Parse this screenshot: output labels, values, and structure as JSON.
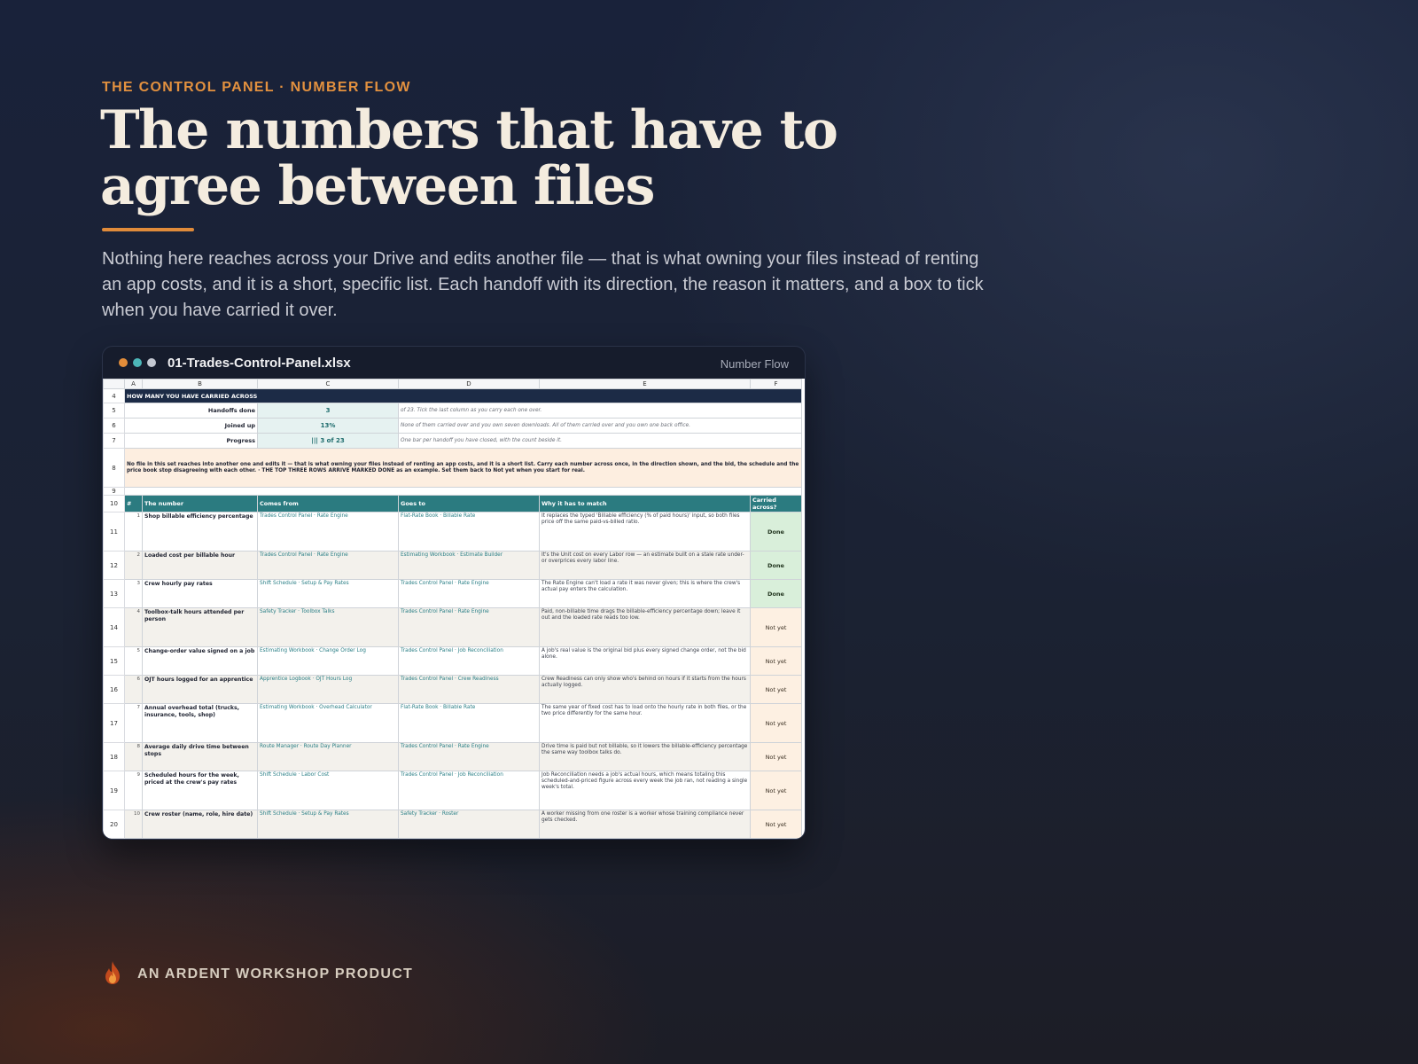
{
  "page": {
    "eyebrow": "THE CONTROL PANEL · NUMBER FLOW",
    "headline": "The numbers that have to agree between files",
    "lead": "Nothing here reaches across your Drive and edits another file — that is what owning your files instead of renting an app costs, and it is a short, specific list. Each handoff with its direction, the reason it matters, and a box to tick when you have carried it over."
  },
  "window": {
    "filename": "01-Trades-Control-Panel.xlsx",
    "tab_label": "Number Flow",
    "dot_colors": [
      "#e38d3a",
      "#4cb6b8",
      "#c4c8d2"
    ]
  },
  "sheet": {
    "columns": [
      "A",
      "B",
      "C",
      "D",
      "E",
      "F"
    ],
    "band_title": "HOW MANY YOU HAVE CARRIED ACROSS",
    "summary": [
      {
        "row": "5",
        "label": "Handoffs done",
        "value": "3",
        "note": "of 23. Tick the last column as you carry each one over."
      },
      {
        "row": "6",
        "label": "Joined up",
        "value": "13%",
        "note": "None of them carried over and you own seven downloads. All of them carried over and you own one back office."
      },
      {
        "row": "7",
        "label": "Progress",
        "value": "||| 3 of 23",
        "note": "One bar per handoff you have closed, with the count beside it."
      }
    ],
    "note_row": "8",
    "note": "No file in this set reaches into another one and edits it — that is what owning your files instead of renting an app costs, and it is a short list. Carry each number across once, in the direction shown, and the bid, the schedule and the price book stop disagreeing with each other.  ·  THE TOP THREE ROWS ARRIVE MARKED DONE as an example. Set them back to Not yet when you start for real.",
    "blank_row": "9",
    "header_row": "10",
    "headers": {
      "num": "#",
      "number": "The number",
      "from": "Comes from",
      "to": "Goes to",
      "why": "Why it has to match",
      "carried": "Carried across?"
    },
    "rows": [
      {
        "row": "11",
        "n": "1",
        "number": "Shop billable efficiency percentage",
        "from": "Trades Control Panel · Rate Engine",
        "to": "Flat-Rate Book · Billable Rate",
        "why": "It replaces the typed 'Billable efficiency (% of paid hours)' input, so both files price off the same paid-vs-billed ratio.",
        "status": "Done"
      },
      {
        "row": "12",
        "n": "2",
        "number": "Loaded cost per billable hour",
        "from": "Trades Control Panel · Rate Engine",
        "to": "Estimating Workbook · Estimate Builder",
        "why": "It's the Unit cost on every Labor row — an estimate built on a stale rate under- or overprices every labor line.",
        "status": "Done"
      },
      {
        "row": "13",
        "n": "3",
        "number": "Crew hourly pay rates",
        "from": "Shift Schedule · Setup & Pay Rates",
        "to": "Trades Control Panel · Rate Engine",
        "why": "The Rate Engine can't load a rate it was never given; this is where the crew's actual pay enters the calculation.",
        "status": "Done"
      },
      {
        "row": "14",
        "n": "4",
        "number": "Toolbox-talk hours attended per person",
        "from": "Safety Tracker · Toolbox Talks",
        "to": "Trades Control Panel · Rate Engine",
        "why": "Paid, non-billable time drags the billable-efficiency percentage down; leave it out and the loaded rate reads too low.",
        "status": "Not yet"
      },
      {
        "row": "15",
        "n": "5",
        "number": "Change-order value signed on a job",
        "from": "Estimating Workbook · Change Order Log",
        "to": "Trades Control Panel · Job Reconciliation",
        "why": "A job's real value is the original bid plus every signed change order, not the bid alone.",
        "status": "Not yet"
      },
      {
        "row": "16",
        "n": "6",
        "number": "OJT hours logged for an apprentice",
        "from": "Apprentice Logbook · OJT Hours Log",
        "to": "Trades Control Panel · Crew Readiness",
        "why": "Crew Readiness can only show who's behind on hours if it starts from the hours actually logged.",
        "status": "Not yet"
      },
      {
        "row": "17",
        "n": "7",
        "number": "Annual overhead total (trucks, insurance, tools, shop)",
        "from": "Estimating Workbook · Overhead Calculator",
        "to": "Flat-Rate Book · Billable Rate",
        "why": "The same year of fixed cost has to load onto the hourly rate in both files, or the two price differently for the same hour.",
        "status": "Not yet"
      },
      {
        "row": "18",
        "n": "8",
        "number": "Average daily drive time between stops",
        "from": "Route Manager · Route Day Planner",
        "to": "Trades Control Panel · Rate Engine",
        "why": "Drive time is paid but not billable, so it lowers the billable-efficiency percentage the same way toolbox talks do.",
        "status": "Not yet"
      },
      {
        "row": "19",
        "n": "9",
        "number": "Scheduled hours for the week, priced at the crew's pay rates",
        "from": "Shift Schedule · Labor Cost",
        "to": "Trades Control Panel · Job Reconciliation",
        "why": "Job Reconciliation needs a job's actual hours, which means totaling this scheduled-and-priced figure across every week the job ran, not reading a single week's total.",
        "status": "Not yet"
      },
      {
        "row": "20",
        "n": "10",
        "number": "Crew roster (name, role, hire date)",
        "from": "Shift Schedule · Setup & Pay Rates",
        "to": "Safety Tracker · Roster",
        "why": "A worker missing from one roster is a worker whose training compliance never gets checked.",
        "status": "Not yet"
      }
    ]
  },
  "footer": {
    "brand": "AN ARDENT WORKSHOP PRODUCT",
    "icon": "flame-icon"
  }
}
